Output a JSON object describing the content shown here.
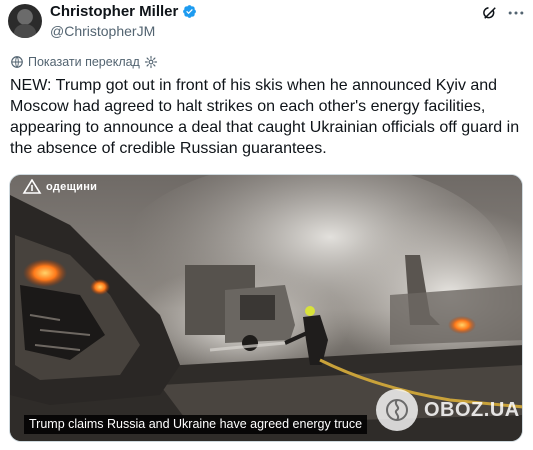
{
  "author": {
    "name": "Christopher Miller",
    "handle": "@ChristopherJM",
    "verified": true
  },
  "translate": {
    "label": "Показати переклад"
  },
  "tweet": {
    "text": "NEW: Trump got out in front of his skis when he announced Kyiv and Moscow had agreed to halt strikes on each other's energy facilities, appearing to announce a deal that caught Ukrainian officials off guard in the absence of credible Russian guarantees."
  },
  "media": {
    "channel_logo_text": "одещини",
    "caption": "Trump claims Russia and Ukraine have agreed energy truce",
    "watermark": "OBOZ.UA"
  },
  "colors": {
    "verified_badge": "#1d9bf0",
    "secondary_text": "#536471",
    "primary_text": "#0f1419"
  },
  "icons": {
    "grok": "grok-icon",
    "more": "more-icon",
    "translate": "globe-icon",
    "settings": "gear-icon"
  }
}
